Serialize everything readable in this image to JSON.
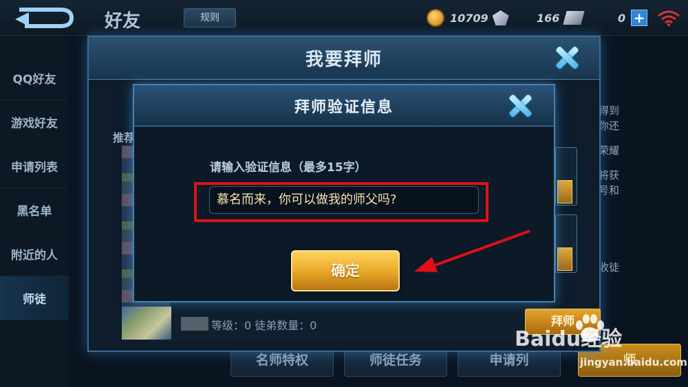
{
  "topbar": {
    "title": "好友",
    "rules_label": "规则",
    "gold": "10709",
    "tickets": "166",
    "diamonds": "0"
  },
  "sidebar": {
    "items": [
      {
        "label": "QQ好友"
      },
      {
        "label": "游戏好友"
      },
      {
        "label": "申请列表"
      },
      {
        "label": "黑名单"
      },
      {
        "label": "附近的人"
      },
      {
        "label": "师徒"
      }
    ]
  },
  "background": {
    "right_text_1": "得到",
    "right_text_2": "你还",
    "right_text_3": "荣耀",
    "right_text_4": "将获",
    "right_text_5": "号和",
    "right_text_6": "收徒",
    "bottom_tabs": [
      "名师特权",
      "师徒任务",
      "申请列",
      "师"
    ]
  },
  "outer_dialog": {
    "title": "我要拜师",
    "recommend_label": "推荐",
    "row_text": "等级：0 徒弟数量：0",
    "master_button": "拜师"
  },
  "inner_dialog": {
    "title": "拜师验证信息",
    "prompt": "请输入验证信息（最多15字）",
    "input_value": "慕名而来，你可以做我的师父吗?",
    "confirm_label": "确定"
  },
  "watermark": {
    "logo": "Baidu经验",
    "url": "jingyan.baidu.com"
  },
  "colors": {
    "highlight_frame": "#e01017",
    "arrow": "#e01017",
    "confirm_gold": "#e7a526"
  }
}
